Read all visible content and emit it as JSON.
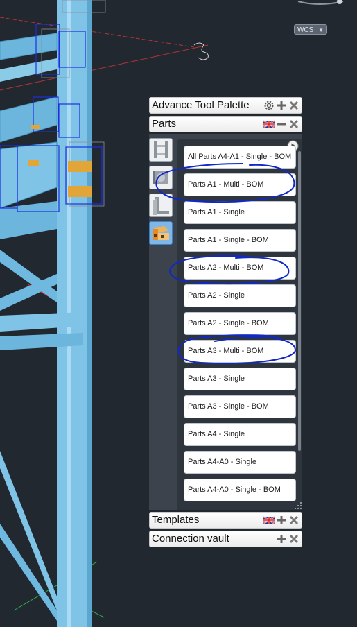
{
  "viewport": {
    "wcs_label": "WCS"
  },
  "tool_palette": {
    "title": "Advance Tool Palette",
    "sections": {
      "parts": "Parts",
      "templates": "Templates",
      "connection_vault": "Connection vault"
    },
    "side_tabs": [
      "beam-section-tab",
      "plate-tab",
      "angle-tab",
      "parts-list-tab"
    ],
    "items": [
      "All Parts A4-A1 - Single - BOM",
      "Parts A1 - Multi - BOM",
      "Parts A1 - Single",
      "Parts A1 - Single - BOM",
      "Parts A2 - Multi - BOM",
      "Parts A2 - Single",
      "Parts A2 - Single - BOM",
      "Parts A3 - Multi - BOM",
      "Parts A3 - Single",
      "Parts A3 - Single - BOM",
      "Parts A4 - Single",
      "Parts A4-A0 - Single",
      "Parts A4-A0 - Single - BOM"
    ]
  },
  "colors": {
    "background": "#212830",
    "steel": "#7fc4e6",
    "annotation": "#1028c8"
  }
}
